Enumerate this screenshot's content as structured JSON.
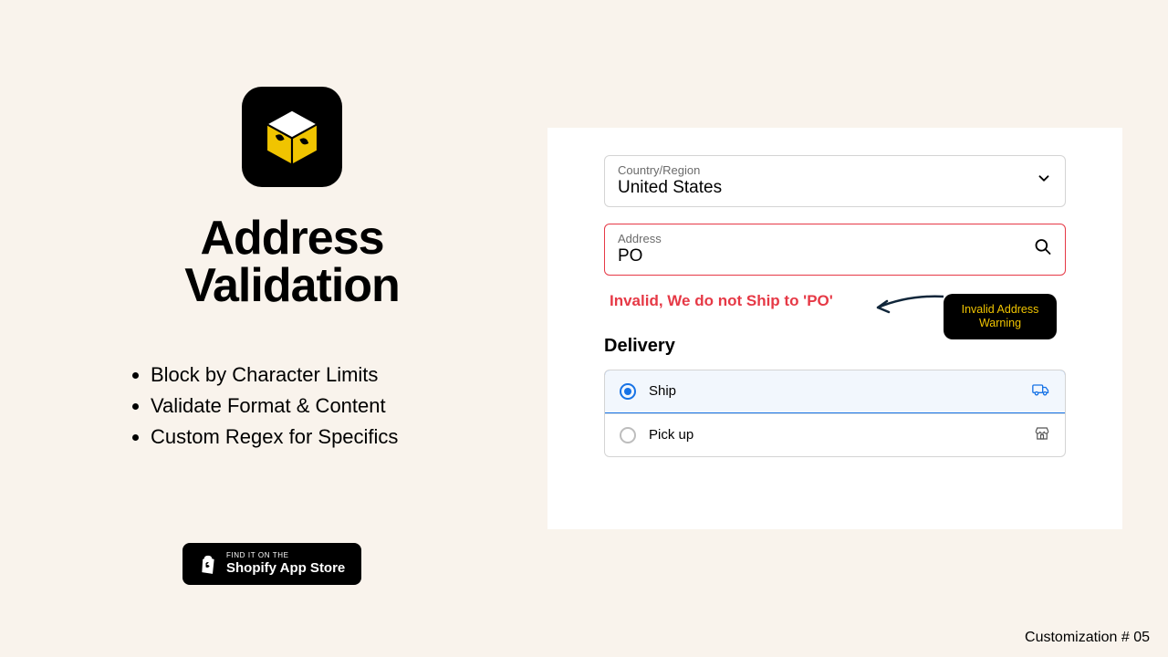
{
  "left": {
    "heading_line1": "Address",
    "heading_line2": "Validation",
    "features": [
      "Block by Character Limits",
      "Validate Format & Content",
      "Custom Regex for Specifics"
    ],
    "badge_small": "FIND IT ON THE",
    "badge_big": "Shopify App Store"
  },
  "form": {
    "country_label": "Country/Region",
    "country_value": "United States",
    "address_label": "Address",
    "address_value": "PO",
    "error_message": "Invalid, We do not Ship to 'PO'",
    "delivery_title": "Delivery",
    "options": [
      {
        "label": "Ship",
        "selected": true
      },
      {
        "label": "Pick up",
        "selected": false
      }
    ]
  },
  "callout": {
    "line1": "Invalid Address",
    "line2": "Warning"
  },
  "footer": "Customization # 05"
}
